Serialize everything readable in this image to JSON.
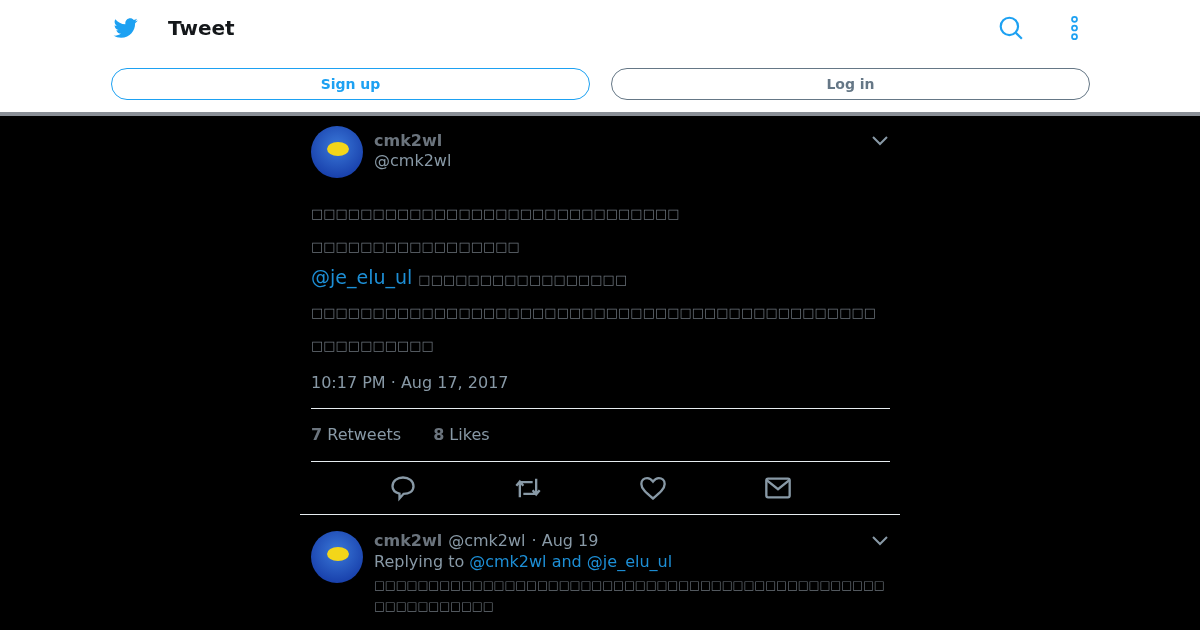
{
  "header": {
    "title": "Tweet",
    "buttons": [
      {
        "label": "Sign up",
        "kind": "primary"
      },
      {
        "label": "Log in",
        "kind": "secondary"
      }
    ]
  },
  "tweet": {
    "name": "cmk2wl",
    "handle": "@cmk2wl",
    "lines": [
      {
        "text": "□□□□□□□□□□□□□□□□□□□□□□□□□□□□□□"
      },
      {
        "text": "□□□□□□□□□□□□□□□□□"
      },
      {
        "mention": "@je_elu_ul",
        "text": "□□□□□□□□□□□□□□□□□"
      },
      {
        "text": "□□□□□□□□□□□□□□□□□□□□□□□□□□□□□□□□□□□□□□□□□□□□□□"
      },
      {
        "text": "□□□□□□□□□□"
      }
    ],
    "timestamp": "10:17 PM · Aug 17, 2017",
    "stats": [
      {
        "count": "7",
        "label": "Retweets"
      },
      {
        "count": "8",
        "label": "Likes"
      }
    ]
  },
  "reply": {
    "name": "cmk2wl",
    "handle": "@cmk2wl",
    "date": "· Aug 19",
    "replying_prefix": "Replying to",
    "replying_to": "@cmk2wl and @je_elu_ul",
    "text": "□□□□□□□□□□□□□□□□□□□□□□□□□□□□□□□□□□□□□□□□□□□□□□□□□□□□□□□□□□"
  }
}
